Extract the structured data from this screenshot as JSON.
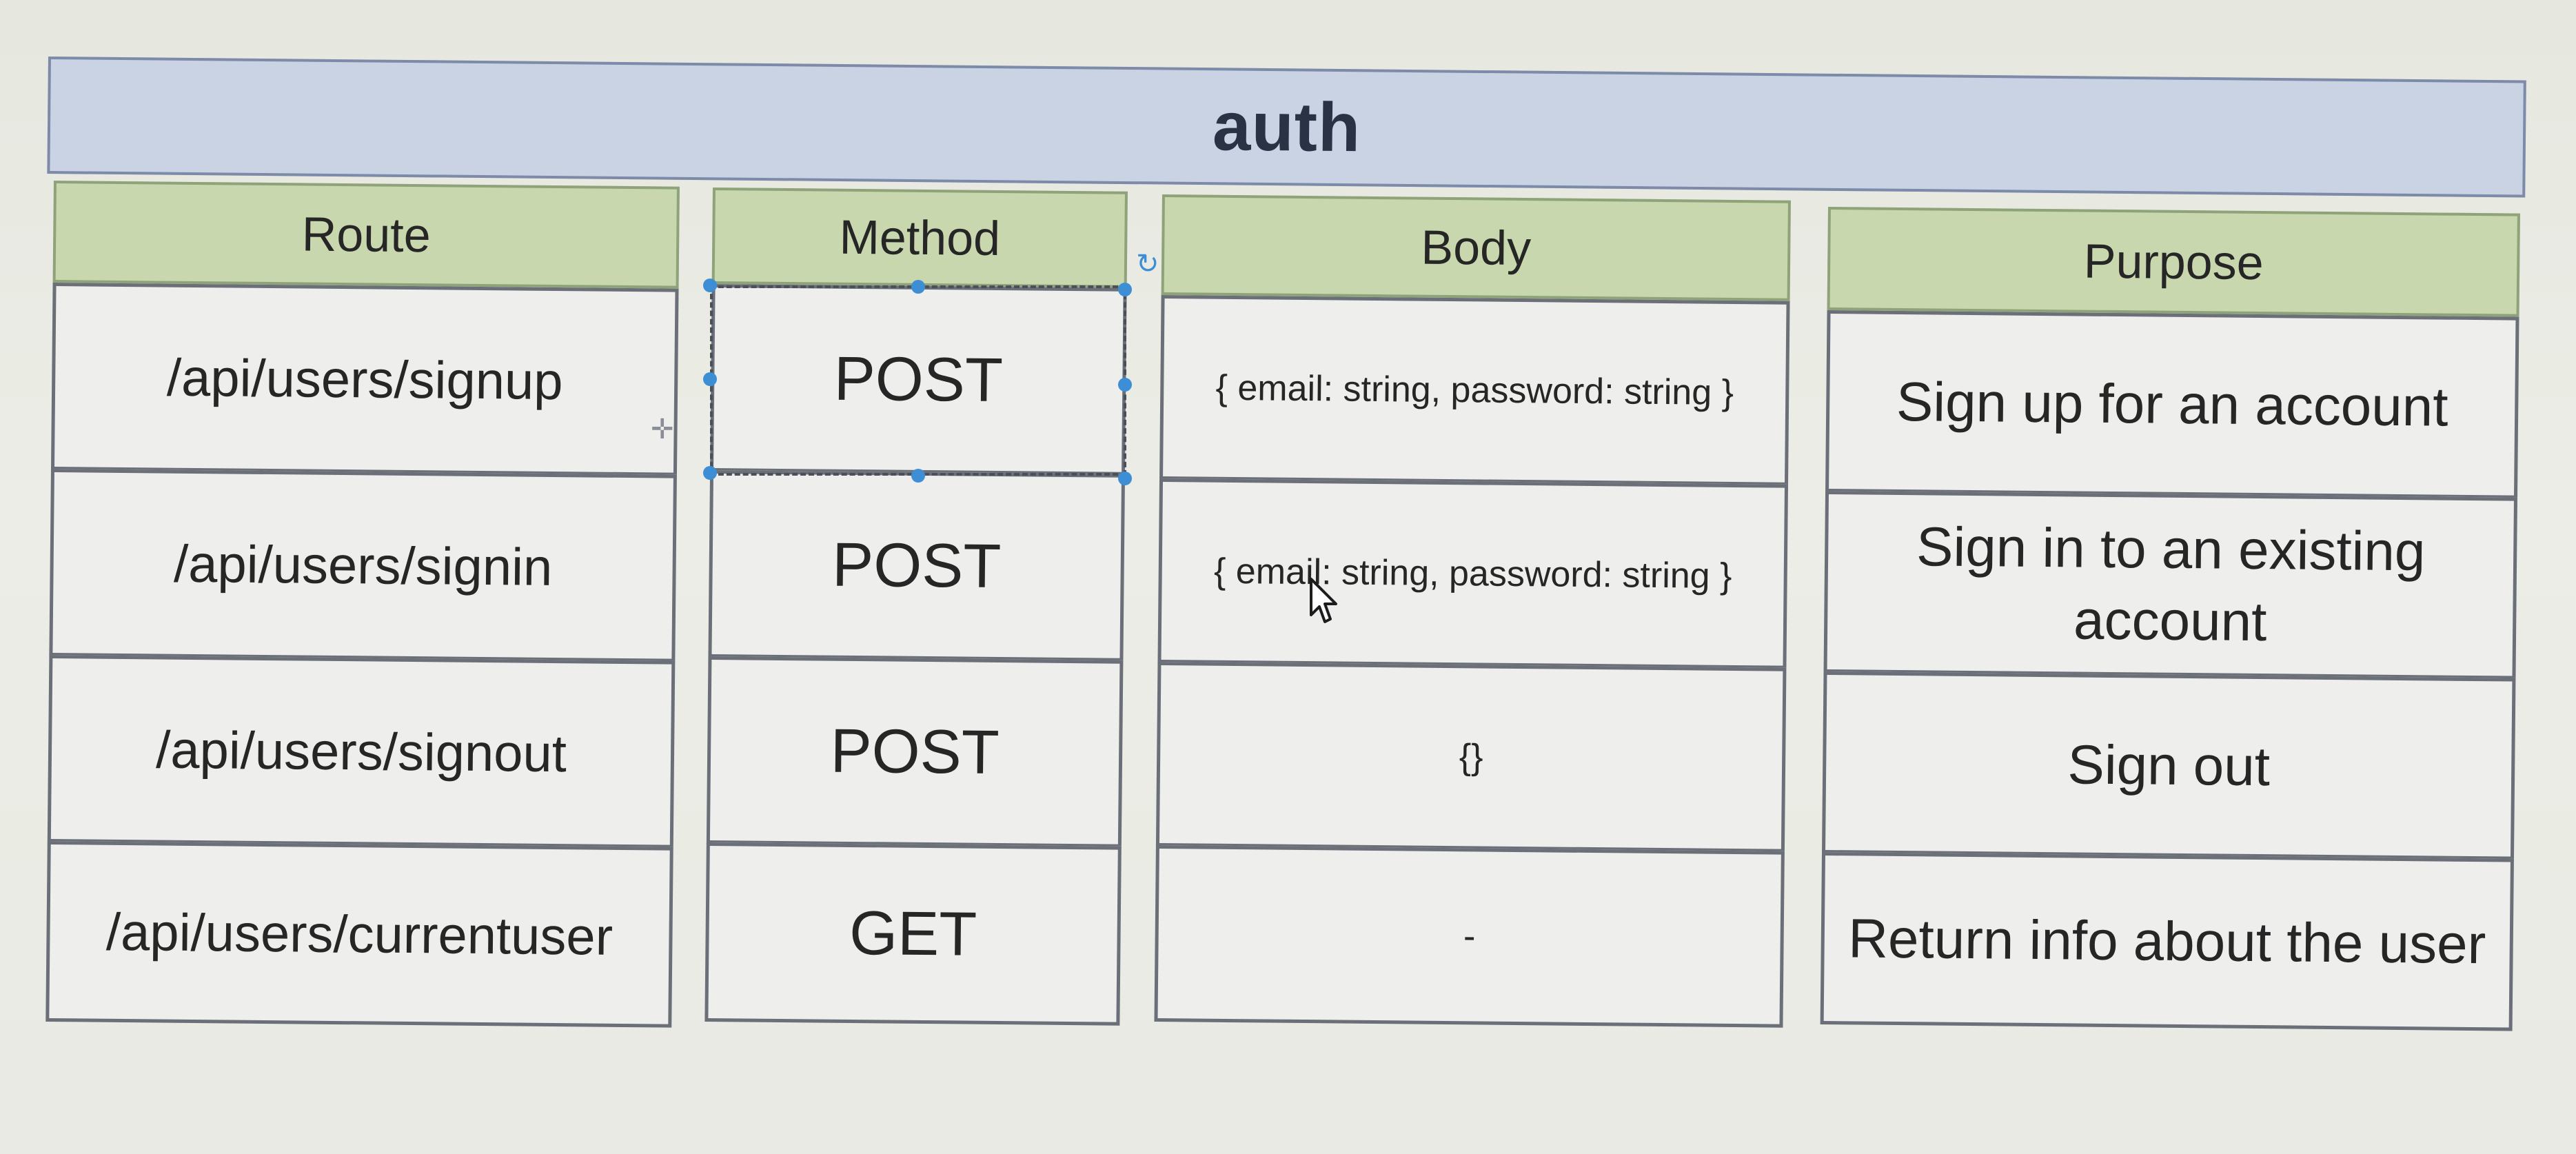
{
  "diagram": {
    "title": "auth",
    "columns": {
      "route": {
        "header": "Route",
        "cells": [
          "/api/users/signup",
          "/api/users/signin",
          "/api/users/signout",
          "/api/users/currentuser"
        ]
      },
      "method": {
        "header": "Method",
        "cells": [
          "POST",
          "POST",
          "POST",
          "GET"
        ]
      },
      "body": {
        "header": "Body",
        "cells": [
          "{ email: string, password: string }",
          "{ email: string, password: string }",
          "{}",
          "-"
        ]
      },
      "purpose": {
        "header": "Purpose",
        "cells": [
          "Sign up for an account",
          "Sign in to an existing account",
          "Sign out",
          "Return info about the user"
        ]
      }
    }
  },
  "colors": {
    "title_fill": "#c9d3e3",
    "header_fill": "#c8d7ad",
    "cell_fill": "#eeeeec",
    "selection": "#3e8ed6"
  },
  "icons": {
    "cursor": "mouse-pointer-icon",
    "rotate": "rotate-handle-icon",
    "move": "plus-cross-icon"
  }
}
